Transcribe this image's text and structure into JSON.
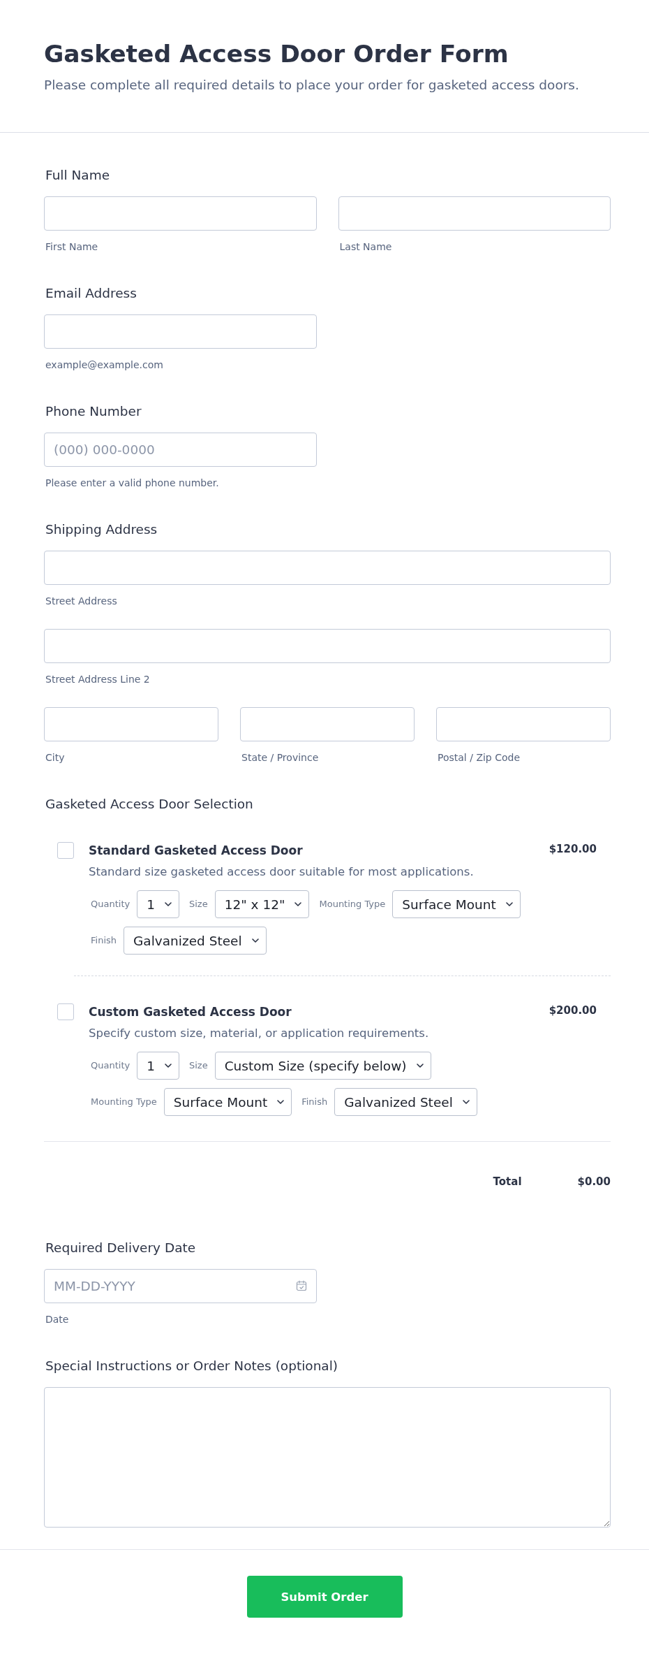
{
  "header": {
    "title": "Gasketed Access Door Order Form",
    "subtitle": "Please complete all required details to place your order for gasketed access doors."
  },
  "full_name": {
    "label": "Full Name",
    "fields": [
      {
        "sublabel": "First Name"
      },
      {
        "sublabel": "Last Name"
      }
    ]
  },
  "email": {
    "label": "Email Address",
    "sublabel": "example@example.com"
  },
  "phone": {
    "label": "Phone Number",
    "placeholder": "(000) 000-0000",
    "sublabel": "Please enter a valid phone number."
  },
  "shipping_address": {
    "label": "Shipping Address",
    "rows": [
      {
        "fields": [
          {
            "sublabel": "Street Address"
          }
        ]
      },
      {
        "fields": [
          {
            "sublabel": "Street Address Line 2"
          }
        ]
      },
      {
        "fields": [
          {
            "sublabel": "City"
          },
          {
            "sublabel": "State / Province"
          },
          {
            "sublabel": "Postal / Zip Code"
          }
        ]
      }
    ]
  },
  "door_selection": {
    "label": "Gasketed Access Door Selection",
    "products": [
      {
        "name": "Standard Gasketed Access Door",
        "price": "$120.00",
        "description": "Standard size gasketed access door suitable for most applications.",
        "checked": false,
        "option_rows": [
          {
            "options": [
              {
                "label": "Quantity",
                "value": "1"
              },
              {
                "label": "Size",
                "value": "12\" x 12\""
              },
              {
                "label": "Mounting Type",
                "value": "Surface Mount"
              }
            ]
          },
          {
            "options": [
              {
                "label": "Finish",
                "value": "Galvanized Steel"
              }
            ]
          }
        ]
      },
      {
        "name": "Custom Gasketed Access Door",
        "price": "$200.00",
        "description": "Specify custom size, material, or application requirements.",
        "checked": false,
        "option_rows": [
          {
            "options": [
              {
                "label": "Quantity",
                "value": "1"
              },
              {
                "label": "Size",
                "value": "Custom Size (specify below)"
              }
            ]
          },
          {
            "options": [
              {
                "label": "Mounting Type",
                "value": "Surface Mount"
              },
              {
                "label": "Finish",
                "value": "Galvanized Steel"
              }
            ]
          }
        ]
      }
    ],
    "total_label": "Total",
    "total": "$0.00"
  },
  "delivery_date": {
    "label": "Required Delivery Date",
    "placeholder": "MM-DD-YYYY",
    "sublabel": "Date"
  },
  "notes": {
    "label": "Special Instructions or Order Notes (optional)"
  },
  "submit_button": {
    "label": "Submit Order"
  }
}
